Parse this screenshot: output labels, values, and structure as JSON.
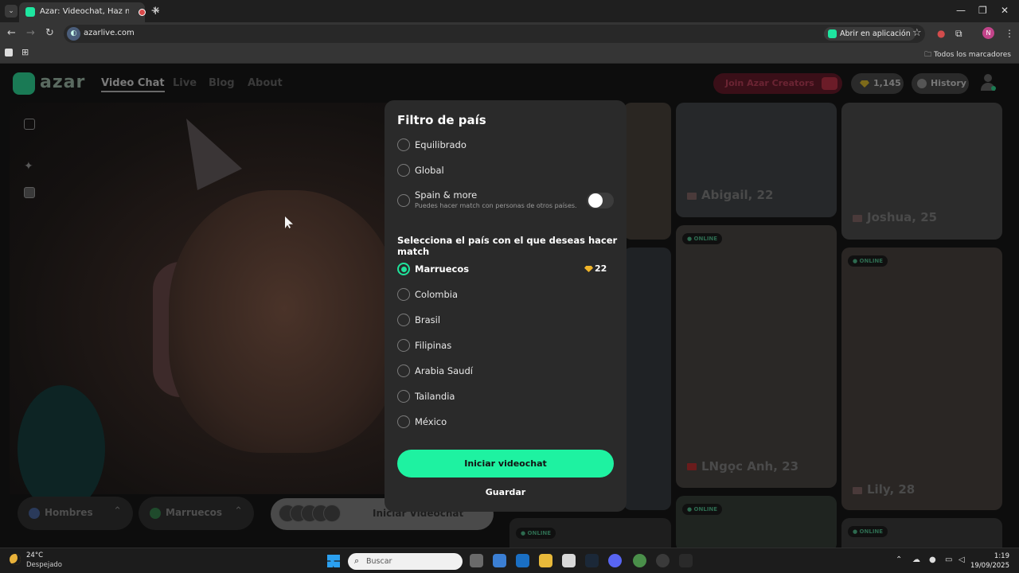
{
  "browser": {
    "tab_title": "Azar: Videochat, Haz nuevo",
    "url": "azarlive.com",
    "open_in_app": "Abrir en aplicación",
    "all_bookmarks": "Todos los marcadores",
    "profile_initial": "N"
  },
  "site": {
    "logo": "azar",
    "nav": [
      "Video Chat",
      "Live",
      "Blog",
      "About"
    ],
    "join_creators": "Join Azar Creators",
    "coins": "1,145",
    "history": "History",
    "gender_filter": "Hombres",
    "country_filter": "Marruecos",
    "start_label": "Iniciar Videochat"
  },
  "cards": [
    {
      "name": "Abigail, 22"
    },
    {
      "name": "Joshua, 25"
    },
    {
      "name": "LNgọc Anh, 23",
      "badge": "ONLINE"
    },
    {
      "name": "Lily, 28",
      "badge": "ONLINE"
    },
    {
      "badge": "ONLINE"
    },
    {
      "badge": "ONLINE"
    },
    {
      "badge": "ONLINE"
    }
  ],
  "modal": {
    "title": "Filtro de país",
    "modes": [
      {
        "label": "Equilibrado",
        "selected": false
      },
      {
        "label": "Global",
        "selected": false
      },
      {
        "label": "Spain & more",
        "selected": false,
        "subtitle": "Puedes hacer match con personas de otros países."
      }
    ],
    "toggle_on": false,
    "section_label": "Selecciona el país con el que deseas hacer match",
    "countries": [
      {
        "label": "Marruecos",
        "selected": true,
        "price": "22"
      },
      {
        "label": "Colombia",
        "selected": false
      },
      {
        "label": "Brasil",
        "selected": false
      },
      {
        "label": "Filipinas",
        "selected": false
      },
      {
        "label": "Arabia Saudí",
        "selected": false
      },
      {
        "label": "Tailandia",
        "selected": false
      },
      {
        "label": "México",
        "selected": false
      }
    ],
    "start_button": "Iniciar videochat",
    "save_button": "Guardar"
  },
  "taskbar": {
    "temperature": "24°C",
    "condition": "Despejado",
    "search_placeholder": "Buscar",
    "time": "1:19",
    "date": "19/09/2025"
  },
  "colors": {
    "accent": "#1ef2a1",
    "modal_bg": "#2a2a2a",
    "gem": "#f0b429"
  }
}
